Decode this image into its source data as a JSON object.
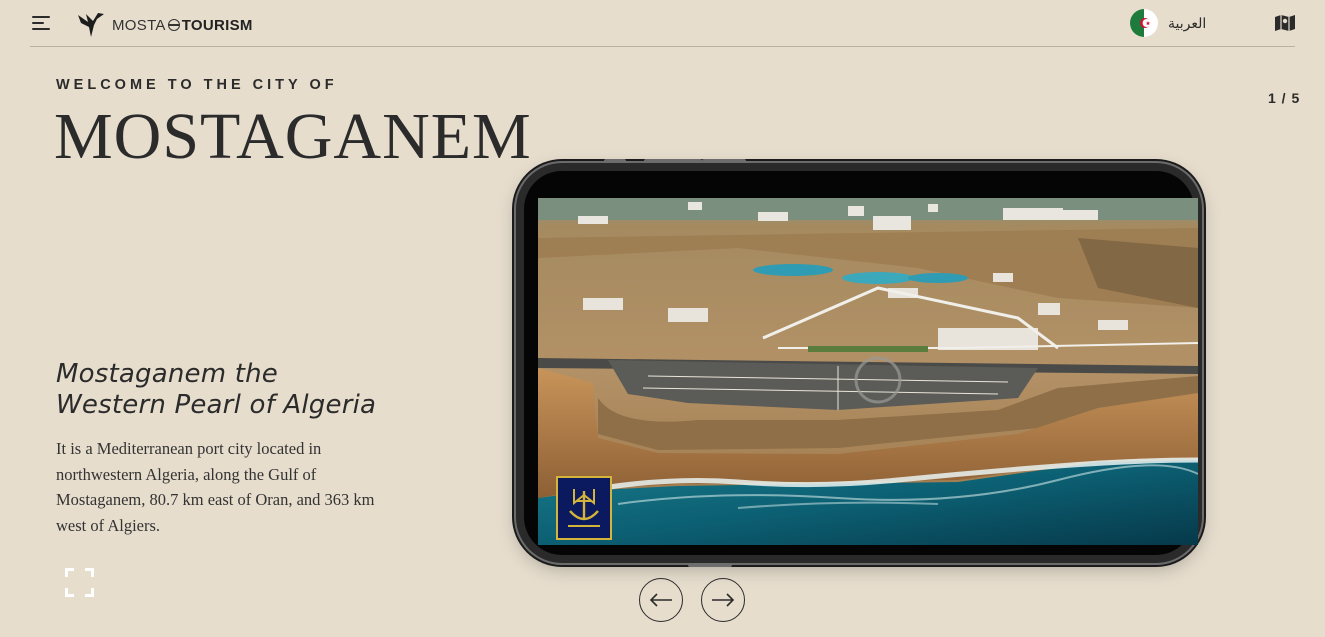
{
  "header": {
    "logo_light": "MOSTA",
    "logo_bold": "TOURISM",
    "language_label": "العربية",
    "menu_icon": "hamburger-menu-icon",
    "map_icon": "map-icon",
    "flag_icon": "algeria-flag-icon"
  },
  "hero": {
    "eyebrow": "WELCOME TO THE CITY OF",
    "title": "MOSTAGANEM",
    "counter": "1 / 5",
    "subtitle_line1": "Mostaganem the",
    "subtitle_line2": "Western Pearl of Algeria",
    "description": "It is a Mediterranean port city located in northwestern Algeria, along the Gulf of Mostaganem, 80.7 km east of Oran, and 363 km west of Algiers."
  },
  "slider": {
    "prev_icon": "arrow-left-icon",
    "next_icon": "arrow-right-icon",
    "fullscreen_icon": "fullscreen-icon",
    "badge_icon": "anchor-emblem-icon"
  },
  "colors": {
    "background": "#e6ddcd",
    "text": "#2b2b2b",
    "sea": "#0e6f80",
    "cliff": "#b07a45"
  }
}
